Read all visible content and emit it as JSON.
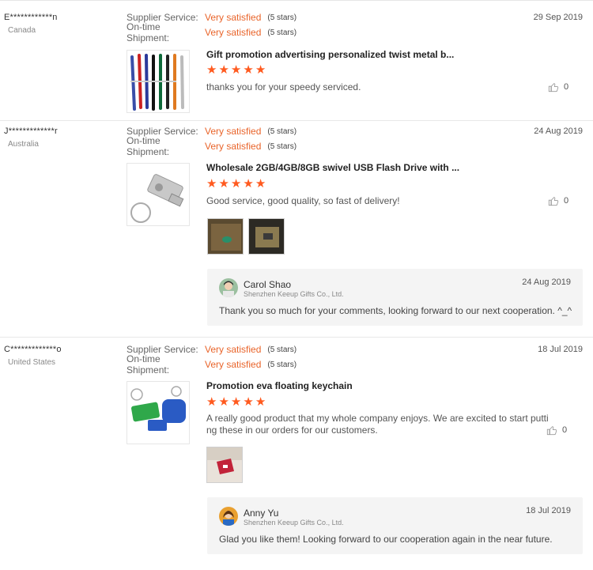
{
  "reviews": [
    {
      "buyer": "E************n",
      "country": "Canada",
      "supplier_label": "Supplier Service:",
      "supplier_value": "Very satisfied",
      "supplier_stars": "(5 stars)",
      "shipment_label": "On-time Shipment:",
      "shipment_value": "Very satisfied",
      "shipment_stars": "(5 stars)",
      "date": "29 Sep 2019",
      "product_title": "Gift promotion advertising personalized twist metal b...",
      "rating": 5,
      "comment": "thanks you for your speedy serviced.",
      "helpful_count": "0"
    },
    {
      "buyer": "J*************r",
      "country": "Australia",
      "supplier_label": "Supplier Service:",
      "supplier_value": "Very satisfied",
      "supplier_stars": "(5 stars)",
      "shipment_label": "On-time Shipment:",
      "shipment_value": "Very satisfied",
      "shipment_stars": "(5 stars)",
      "date": "24 Aug 2019",
      "product_title": "Wholesale 2GB/4GB/8GB swivel USB Flash Drive with ...",
      "rating": 5,
      "comment": "Good service, good quality, so fast of delivery!",
      "helpful_count": "0",
      "reply": {
        "name": "Carol Shao",
        "company": "Shenzhen Keeup Gifts Co., Ltd.",
        "date": "24 Aug 2019",
        "text": "Thank you so much for your comments, looking forward to our next cooperation.  ^_^"
      }
    },
    {
      "buyer": "C*************o",
      "country": "United States",
      "supplier_label": "Supplier Service:",
      "supplier_value": "Very satisfied",
      "supplier_stars": "(5 stars)",
      "shipment_label": "On-time Shipment:",
      "shipment_value": "Very satisfied",
      "shipment_stars": "(5 stars)",
      "date": "18 Jul 2019",
      "product_title": "Promotion eva floating keychain",
      "rating": 5,
      "comment_line1": "A really good product that my whole company enjoys. We are excited to start putti",
      "comment_line2": "ng these in our orders for our customers.",
      "helpful_count": "0",
      "reply": {
        "name": "Anny Yu",
        "company": "Shenzhen Keeup Gifts Co., Ltd.",
        "date": "18 Jul 2019",
        "text": "Glad you like them! Looking forward to our cooperation again in the near future."
      }
    }
  ],
  "colors": {
    "accent": "#e9642a",
    "star": "#ff5a1f"
  },
  "icons": {
    "helpful": "thumbs-up-icon",
    "rating": "star-icon"
  }
}
